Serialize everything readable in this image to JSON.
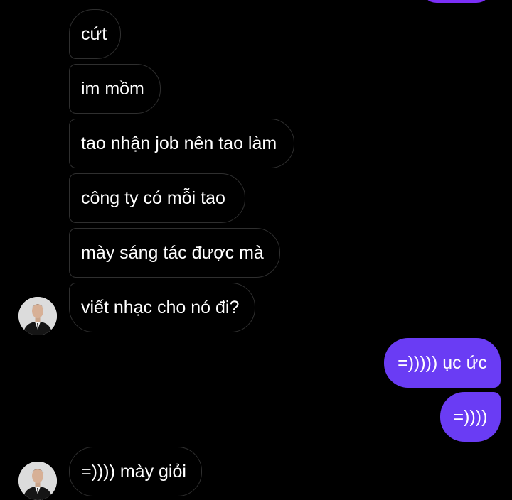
{
  "thread": {
    "incoming_group_1": [
      "cứt",
      "im mồm",
      "tao nhận job nên tao làm",
      "công ty có mỗi tao",
      "mày sáng tác được mà",
      "viết nhạc cho nó đi?"
    ],
    "outgoing_group": [
      "=))))) ục ức",
      "=))))"
    ],
    "incoming_group_2": [
      "=)))) mày giỏi"
    ]
  },
  "contact": {
    "avatar_icon": "person-suit-avatar-icon"
  },
  "colors": {
    "background": "#000000",
    "outgoing_bubble": "#6a3cf4",
    "top_partial_bubble": "#7b2ff7",
    "incoming_border": "#2f2f2f",
    "text": "#ffffff"
  }
}
